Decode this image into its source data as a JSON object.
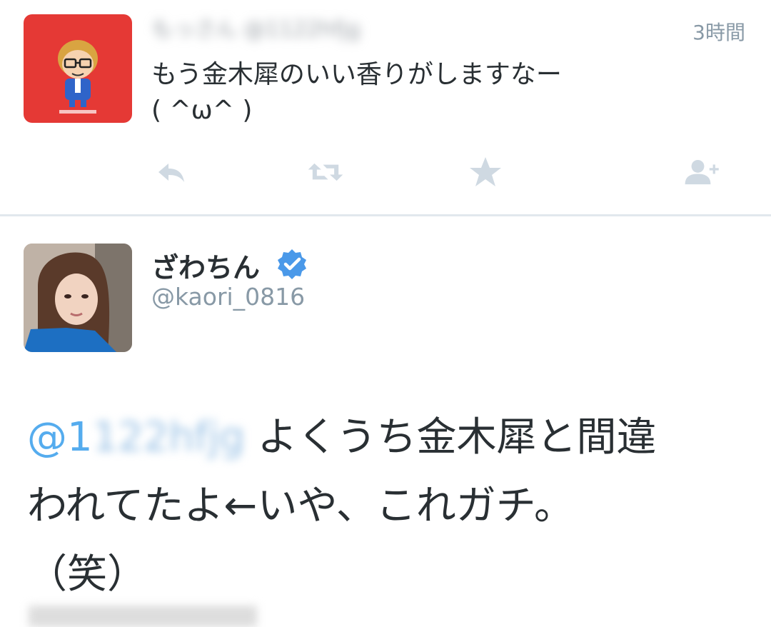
{
  "tweet1": {
    "display_name": "もっさん",
    "handle": "@1122hfjg",
    "time": "3時間",
    "text_line1": "もう金木犀のいい香りがしますなー",
    "text_line2": "( ^ω^ )",
    "actions": {
      "reply": "reply-icon",
      "retweet": "retweet-icon",
      "favorite": "star-icon",
      "follow": "follow-icon"
    }
  },
  "tweet2": {
    "display_name": "ざわちん",
    "handle": "@kaori_0816",
    "mention_prefix": "@1",
    "mention_rest": "122hfjg",
    "body_line1": " よくうち金木犀と間違",
    "body_line2": "われてたよ←いや、これガチ。",
    "body_line3": "（笑）"
  },
  "colors": {
    "link": "#55acee",
    "muted": "#8899a6",
    "verified": "#4a99e9",
    "avatar1_bg": "#e53935"
  }
}
